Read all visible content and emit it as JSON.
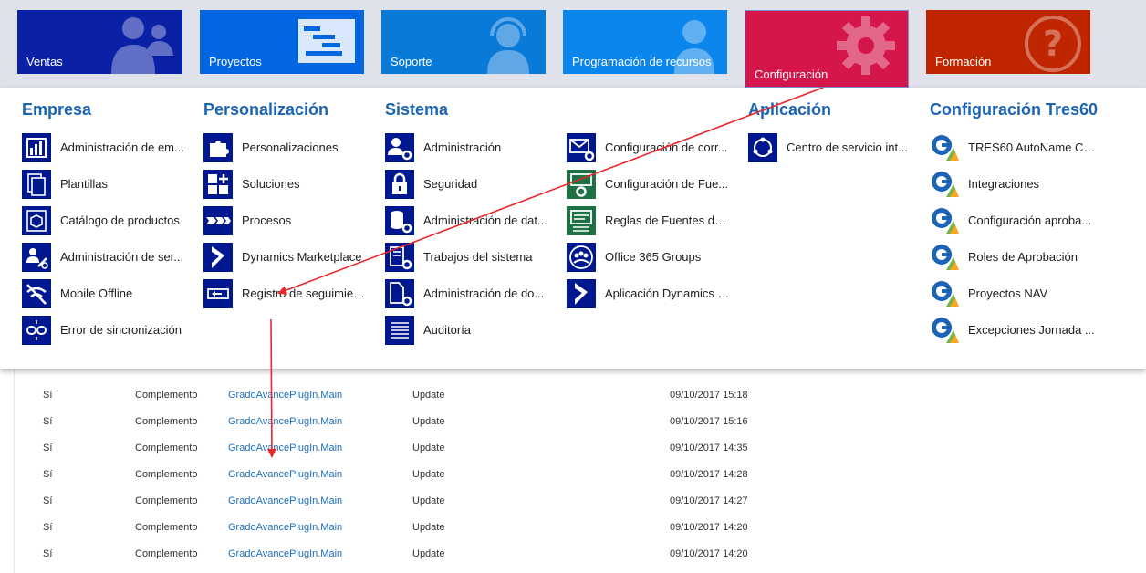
{
  "nav": {
    "tiles": [
      {
        "label": "Ventas"
      },
      {
        "label": "Proyectos"
      },
      {
        "label": "Soporte"
      },
      {
        "label": "Programación de recursos"
      },
      {
        "label": "Configuración"
      },
      {
        "label": "Formación"
      }
    ]
  },
  "columns": [
    {
      "title": "Empresa",
      "items": [
        {
          "label": "Administración de em..."
        },
        {
          "label": "Plantillas"
        },
        {
          "label": "Catálogo de productos"
        },
        {
          "label": "Administración de ser..."
        },
        {
          "label": "Mobile Offline"
        },
        {
          "label": "Error de sincronización"
        }
      ]
    },
    {
      "title": "Personalización",
      "items": [
        {
          "label": "Personalizaciones"
        },
        {
          "label": "Soluciones"
        },
        {
          "label": "Procesos"
        },
        {
          "label": "Dynamics Marketplace"
        },
        {
          "label": "Registro de seguimien..."
        }
      ]
    },
    {
      "title": "Sistema",
      "items": [
        {
          "label": "Administración"
        },
        {
          "label": "Seguridad"
        },
        {
          "label": "Administración de dat..."
        },
        {
          "label": "Trabajos del sistema"
        },
        {
          "label": "Administración de do..."
        },
        {
          "label": "Auditoría"
        }
      ]
    },
    {
      "title": "",
      "items": [
        {
          "label": "Configuración de corr..."
        },
        {
          "label": "Configuración de Fue..."
        },
        {
          "label": "Reglas de Fuentes de ..."
        },
        {
          "label": "Office 365 Groups"
        },
        {
          "label": "Aplicación Dynamics 3..."
        }
      ]
    },
    {
      "title": "Aplicación",
      "items": [
        {
          "label": "Centro de servicio int..."
        }
      ]
    },
    {
      "title": "Configuración Tres60",
      "items": [
        {
          "label": "TRES60 AutoName Co..."
        },
        {
          "label": "Integraciones"
        },
        {
          "label": "Configuración aproba..."
        },
        {
          "label": "Roles de Aprobación"
        },
        {
          "label": "Proyectos NAV"
        },
        {
          "label": "Excepciones Jornada ..."
        }
      ]
    }
  ],
  "table": {
    "rows": [
      {
        "c1": "Sí",
        "c2": "Complemento",
        "c3": "GradoAvancePlugIn.Main",
        "c4": "Update",
        "c5": "09/10/2017 15:18"
      },
      {
        "c1": "Sí",
        "c2": "Complemento",
        "c3": "GradoAvancePlugIn.Main",
        "c4": "Update",
        "c5": "09/10/2017 15:16"
      },
      {
        "c1": "Sí",
        "c2": "Complemento",
        "c3": "GradoAvancePlugIn.Main",
        "c4": "Update",
        "c5": "09/10/2017 14:35"
      },
      {
        "c1": "Sí",
        "c2": "Complemento",
        "c3": "GradoAvancePlugIn.Main",
        "c4": "Update",
        "c5": "09/10/2017 14:28"
      },
      {
        "c1": "Sí",
        "c2": "Complemento",
        "c3": "GradoAvancePlugIn.Main",
        "c4": "Update",
        "c5": "09/10/2017 14:27"
      },
      {
        "c1": "Sí",
        "c2": "Complemento",
        "c3": "GradoAvancePlugIn.Main",
        "c4": "Update",
        "c5": "09/10/2017 14:20"
      },
      {
        "c1": "Sí",
        "c2": "Complemento",
        "c3": "GradoAvancePlugIn.Main",
        "c4": "Update",
        "c5": "09/10/2017 14:20"
      }
    ]
  },
  "colors": {
    "config_tile": "#d5164a",
    "heading": "#1c64b4",
    "icon_bg": "#00188f",
    "annotation_arrow": "#e8262b"
  }
}
